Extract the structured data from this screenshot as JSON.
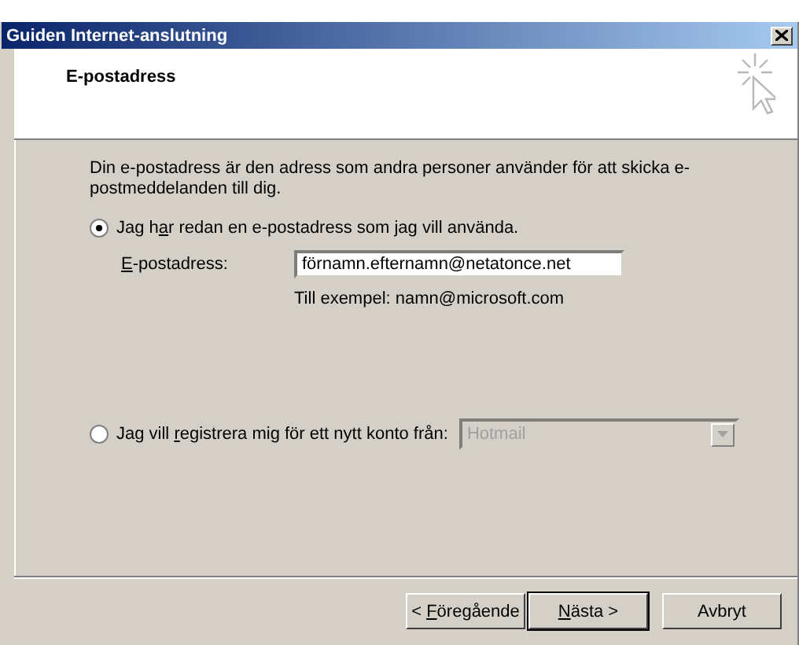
{
  "window": {
    "title": "Guiden Internet-anslutning"
  },
  "header": {
    "title": "E-postadress"
  },
  "intro": "Din e-postadress är den adress som andra personer använder för att skicka e-postmeddelanden till dig.",
  "options": [
    {
      "kind": "field",
      "selected": true,
      "label": {
        "before": "Jag h",
        "key": "a",
        "after": "r redan en e-postadress som jag vill använda."
      },
      "field_label": {
        "key": "E",
        "after": "-postadress:"
      },
      "value": "förnamn.efternamn@netatonce.net",
      "hint": "Till exempel: namn@microsoft.com"
    },
    {
      "kind": "dropdown",
      "selected": false,
      "label": {
        "before": "Jag vill ",
        "key": "r",
        "after": "egistrera mig för ett nytt konto från:"
      },
      "value": "Hotmail",
      "disabled": true
    }
  ],
  "buttons": [
    {
      "label": {
        "before": "< ",
        "key": "F",
        "after": "öregående"
      },
      "default": false
    },
    {
      "label": {
        "key": "N",
        "after": "ästa >"
      },
      "default": true
    },
    {
      "label": {
        "before": "Avbryt"
      },
      "default": false
    }
  ]
}
